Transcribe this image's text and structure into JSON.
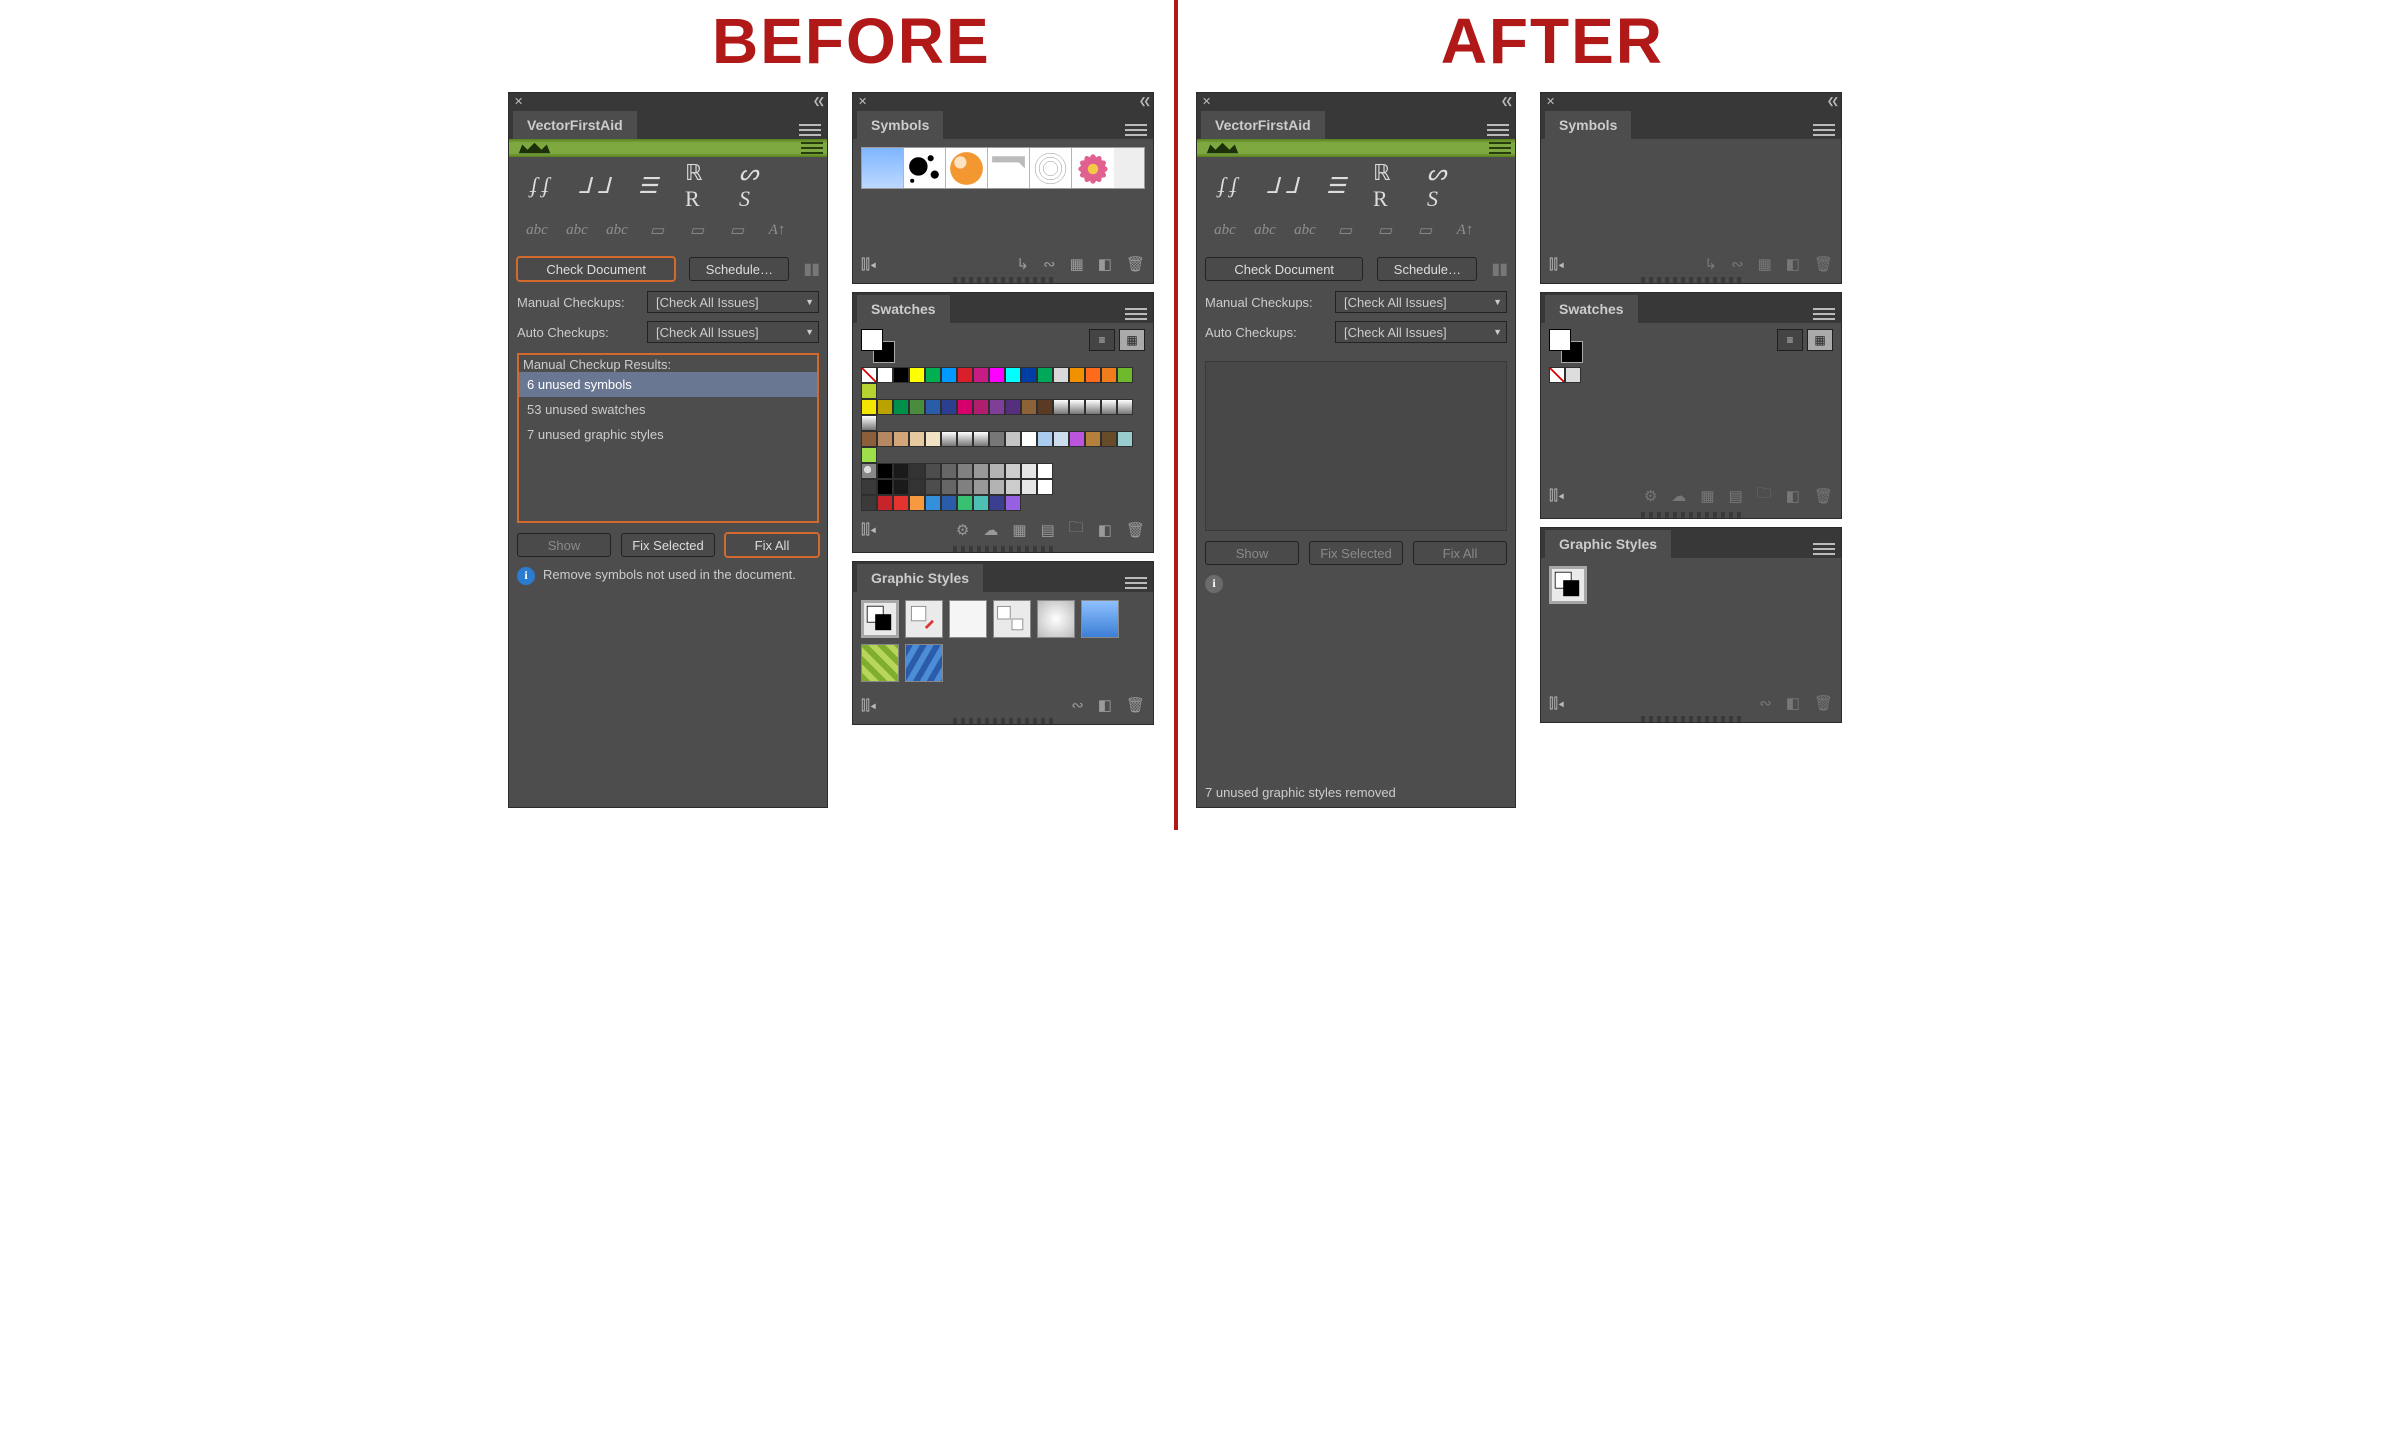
{
  "headings": {
    "before": "BEFORE",
    "after": "AFTER"
  },
  "colors": {
    "accent_red": "#b11818",
    "highlight": "#d26a2e",
    "green_bar": "#7ea940"
  },
  "vfa": {
    "title": "VectorFirstAid",
    "check_doc_btn": "Check Document",
    "schedule_btn": "Schedule…",
    "manual_label": "Manual Checkups:",
    "auto_label": "Auto Checkups:",
    "dd_value": "[Check All Issues]",
    "results_title": "Manual Checkup Results:",
    "results": [
      "6 unused symbols",
      "53 unused swatches",
      "7 unused graphic styles"
    ],
    "show_btn": "Show",
    "fix_sel_btn": "Fix Selected",
    "fix_all_btn": "Fix All",
    "info_text": "Remove symbols not used in the document."
  },
  "after_status": "7 unused graphic styles removed",
  "symbols": {
    "title": "Symbols",
    "thumbs": [
      "gradient",
      "ink-splat",
      "glossy-ball",
      "ribbon",
      "mesh-sphere",
      "flower"
    ]
  },
  "swatches": {
    "title": "Swatches",
    "grid_rows": [
      [
        "none",
        "#ffffff",
        "#000000",
        "#ffff00",
        "#00b050",
        "#0099ff",
        "#d91f2b",
        "#c81b84",
        "#ff00ff",
        "#00ffff",
        "#003da5",
        "#00a859",
        "#d9d9d9",
        "#f29100",
        "#ff6b1a",
        "#f07c1b",
        "#6fba2c",
        "#b7d332"
      ],
      [
        "#f4e600",
        "#baa200",
        "#00904a",
        "#498c3d",
        "#2a5caa",
        "#2a3f8f",
        "#d6006c",
        "#b21e6f",
        "#7f3f98",
        "#562e7e",
        "#8c6239",
        "#5a3a22",
        "#grad1",
        "#grad2",
        "#grad3",
        "#grad4",
        "#grad5",
        "#grad6"
      ],
      [
        "#8b5e3c",
        "#b58863",
        "#d2a679",
        "#e6c99f",
        "#f2e2c4",
        "#grad7",
        "#grad8",
        "#grad9",
        "#777777",
        "#c5c5c5",
        "#ffffff",
        "#aaccee",
        "#cde",
        "#b5d",
        "#b5803c",
        "#684c2a",
        "#9cc",
        "#9de04a"
      ],
      [
        "pattern",
        "#000000",
        "#1a1a1a",
        "#333333",
        "#4d4d4d",
        "#666666",
        "#808080",
        "#999999",
        "#b3b3b3",
        "#cccccc",
        "#e6e6e6",
        "#ffffff"
      ],
      [
        "folder",
        "#000000",
        "#1a1a1a",
        "#333333",
        "#4d4d4d",
        "#666666",
        "#808080",
        "#999999",
        "#b3b3b3",
        "#cccccc",
        "#e6e6e6",
        "#ffffff"
      ],
      [
        "folder",
        "#c7232a",
        "#e3342f",
        "#f6993f",
        "#3490dc",
        "#2a5caa",
        "#38c172",
        "#4dc0b5",
        "#3a3f8f",
        "#9561e2"
      ]
    ],
    "after_singletons": [
      "none",
      "#ffffff"
    ]
  },
  "gstyles": {
    "title": "Graphic Styles",
    "before_count": 8,
    "after_count": 1
  },
  "icon_labels": {
    "library": "library-icon",
    "share": "share-icon",
    "cloud": "cloud-icon",
    "grid": "grid-icon",
    "list": "list-icon",
    "folder": "folder-icon",
    "new": "new-icon",
    "trash": "trash-icon",
    "link": "link-break-icon",
    "arrow": "arrow-icon",
    "dup": "duplicate-icon"
  }
}
